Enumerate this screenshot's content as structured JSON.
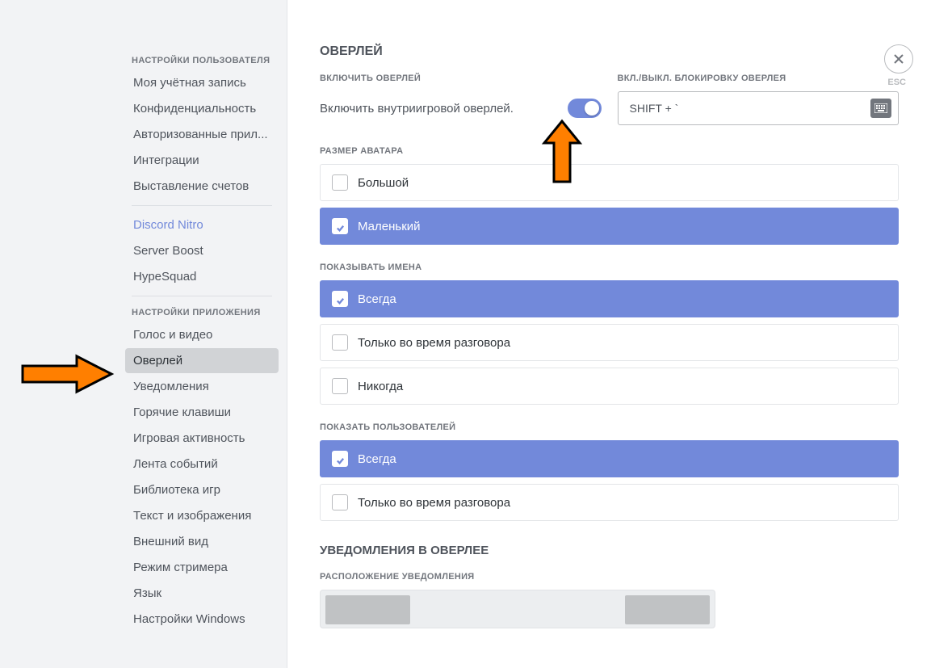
{
  "sidebar": {
    "section1_header": "НАСТРОЙКИ ПОЛЬЗОВАТЕЛЯ",
    "items1": {
      "account": "Моя учётная запись",
      "privacy": "Конфиденциальность",
      "authorized": "Авторизованные прил...",
      "integrations": "Интеграции",
      "billing": "Выставление счетов"
    },
    "items2": {
      "nitro": "Discord Nitro",
      "boost": "Server Boost",
      "hypesquad": "HypeSquad"
    },
    "section3_header": "НАСТРОЙКИ ПРИЛОЖЕНИЯ",
    "items3": {
      "voice": "Голос и видео",
      "overlay": "Оверлей",
      "notifications": "Уведомления",
      "keybinds": "Горячие клавиши",
      "activity": "Игровая активность",
      "feed": "Лента событий",
      "library": "Библиотека игр",
      "text_images": "Текст и изображения",
      "appearance": "Внешний вид",
      "streamer": "Режим стримера",
      "language": "Язык",
      "windows": "Настройки Windows"
    }
  },
  "main": {
    "title": "ОВЕРЛЕЙ",
    "enable_label": "ВКЛЮЧИТЬ ОВЕРЛЕЙ",
    "enable_text": "Включить внутриигровой оверлей.",
    "lock_label": "ВКЛ./ВЫКЛ. БЛОКИРОВКУ ОВЕРЛЕЯ",
    "keybind_value": "SHIFT + `",
    "avatar_size_label": "РАЗМЕР АВАТАРА",
    "avatar_options": {
      "large": "Большой",
      "small": "Маленький"
    },
    "show_names_label": "ПОКАЗЫВАТЬ ИМЕНА",
    "names_options": {
      "always": "Всегда",
      "speaking": "Только во время разговора",
      "never": "Никогда"
    },
    "show_users_label": "ПОКАЗАТЬ ПОЛЬЗОВАТЕЛЕЙ",
    "users_options": {
      "always": "Всегда",
      "speaking": "Только во время разговора"
    },
    "notif_title": "УВЕДОМЛЕНИЯ В ОВЕРЛЕЕ",
    "notif_pos_label": "РАСПОЛОЖЕНИЕ УВЕДОМЛЕНИЯ"
  },
  "close": {
    "esc": "ESC"
  }
}
